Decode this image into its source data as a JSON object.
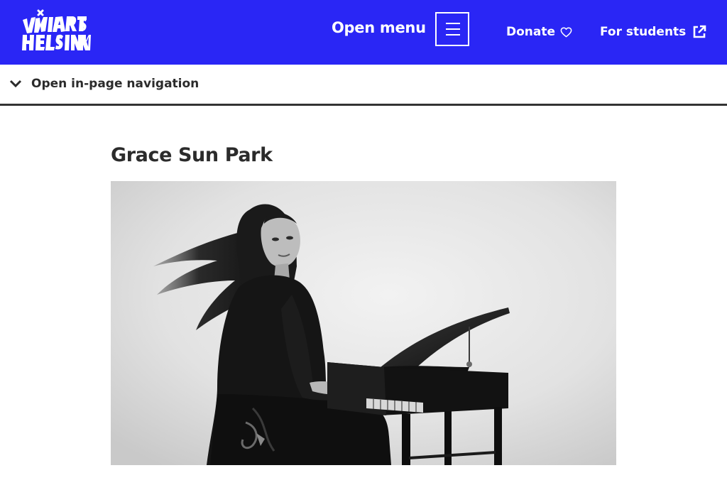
{
  "header": {
    "logo_alt": "Uniarts Helsinki",
    "menu_label": "Open menu",
    "donate_label": "Donate",
    "students_label": "For students",
    "background_color": "#2a26f5",
    "icons": {
      "menu": "hamburger-icon",
      "donate": "heart-icon",
      "students": "external-link-icon"
    }
  },
  "inpage_nav": {
    "label": "Open in-page navigation",
    "icon": "chevron-down-icon"
  },
  "main": {
    "title": "Grace Sun Park",
    "photo_alt": "Grace Sun Park playing a small grand piano"
  }
}
